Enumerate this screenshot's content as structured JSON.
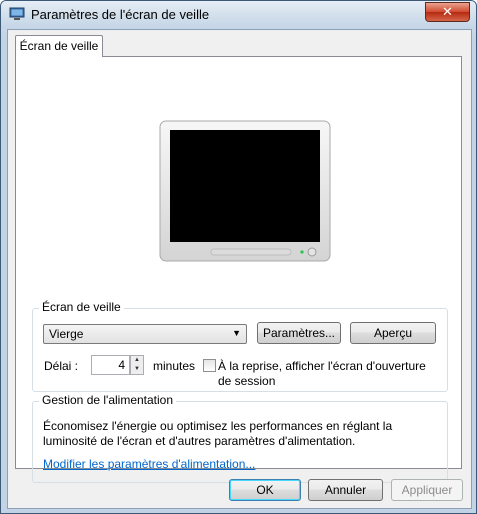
{
  "window": {
    "title": "Paramètres de l'écran de veille",
    "close_label": "✕"
  },
  "tab": {
    "label": "Écran de veille"
  },
  "screensaver": {
    "group_label": "Écran de veille",
    "selected": "Vierge",
    "settings_button": "Paramètres...",
    "preview_button": "Aperçu",
    "delay_label": "Délai :",
    "delay_value": "4",
    "minutes_label": "minutes",
    "resume_label_line1": "À la reprise, afficher l'écran d'ouverture",
    "resume_label_line2": "de session",
    "resume_checked": false
  },
  "power": {
    "group_label": "Gestion de l'alimentation",
    "description_line1": "Économisez l'énergie ou optimisez les performances en réglant la",
    "description_line2": "luminosité de l'écran et d'autres paramètres d'alimentation.",
    "link": "Modifier les paramètres d'alimentation..."
  },
  "buttons": {
    "ok": "OK",
    "cancel": "Annuler",
    "apply": "Appliquer"
  },
  "colors": {
    "accent": "#0066cc",
    "close": "#cf4a2f"
  }
}
